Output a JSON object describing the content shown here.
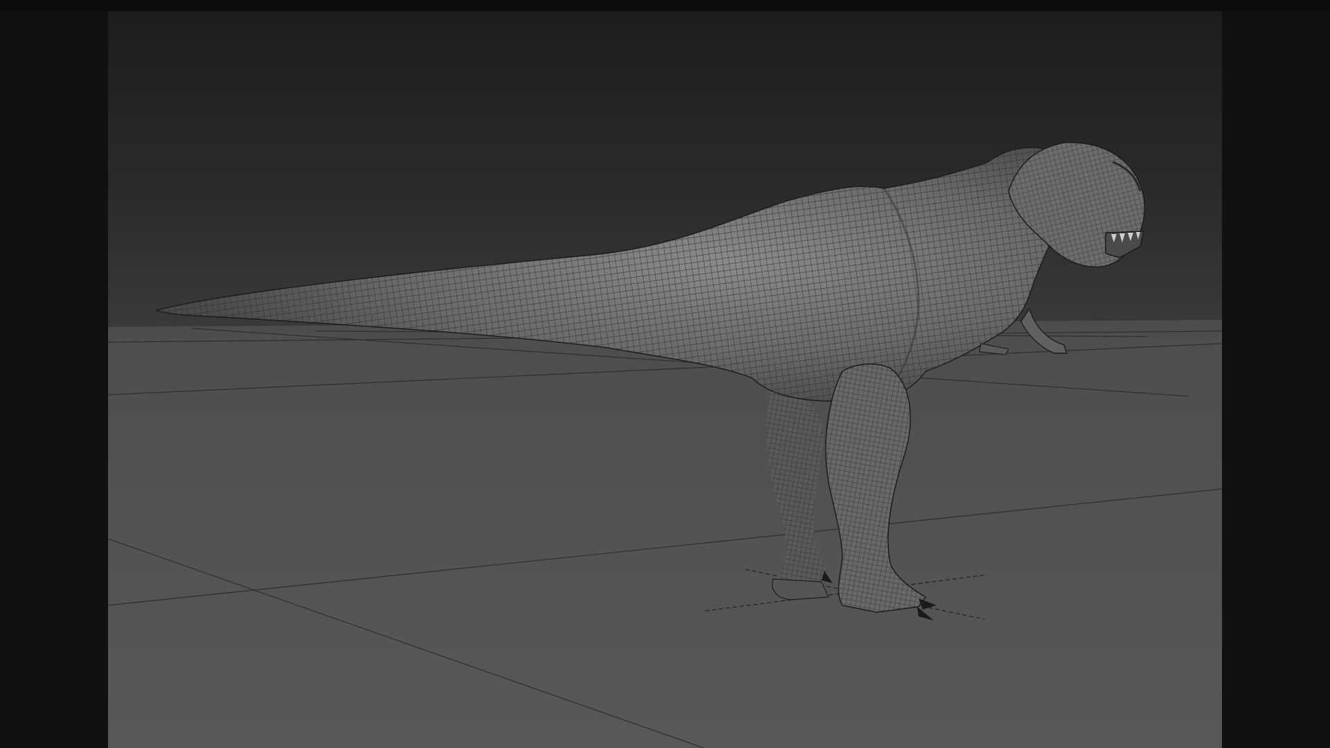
{
  "window": {
    "title": ""
  },
  "viewport": {
    "subject": "t-rex-model",
    "display_mode": "wireframe-on-shaded",
    "grid_visible": true
  },
  "colors": {
    "background_top": "#1c1c1c",
    "background_bottom": "#3a3a3a",
    "ground": "#555555",
    "grid_line": "#2a2a2a",
    "model_fill": "#6e6e6e",
    "wire": "#262626",
    "letterbox": "#111111"
  }
}
